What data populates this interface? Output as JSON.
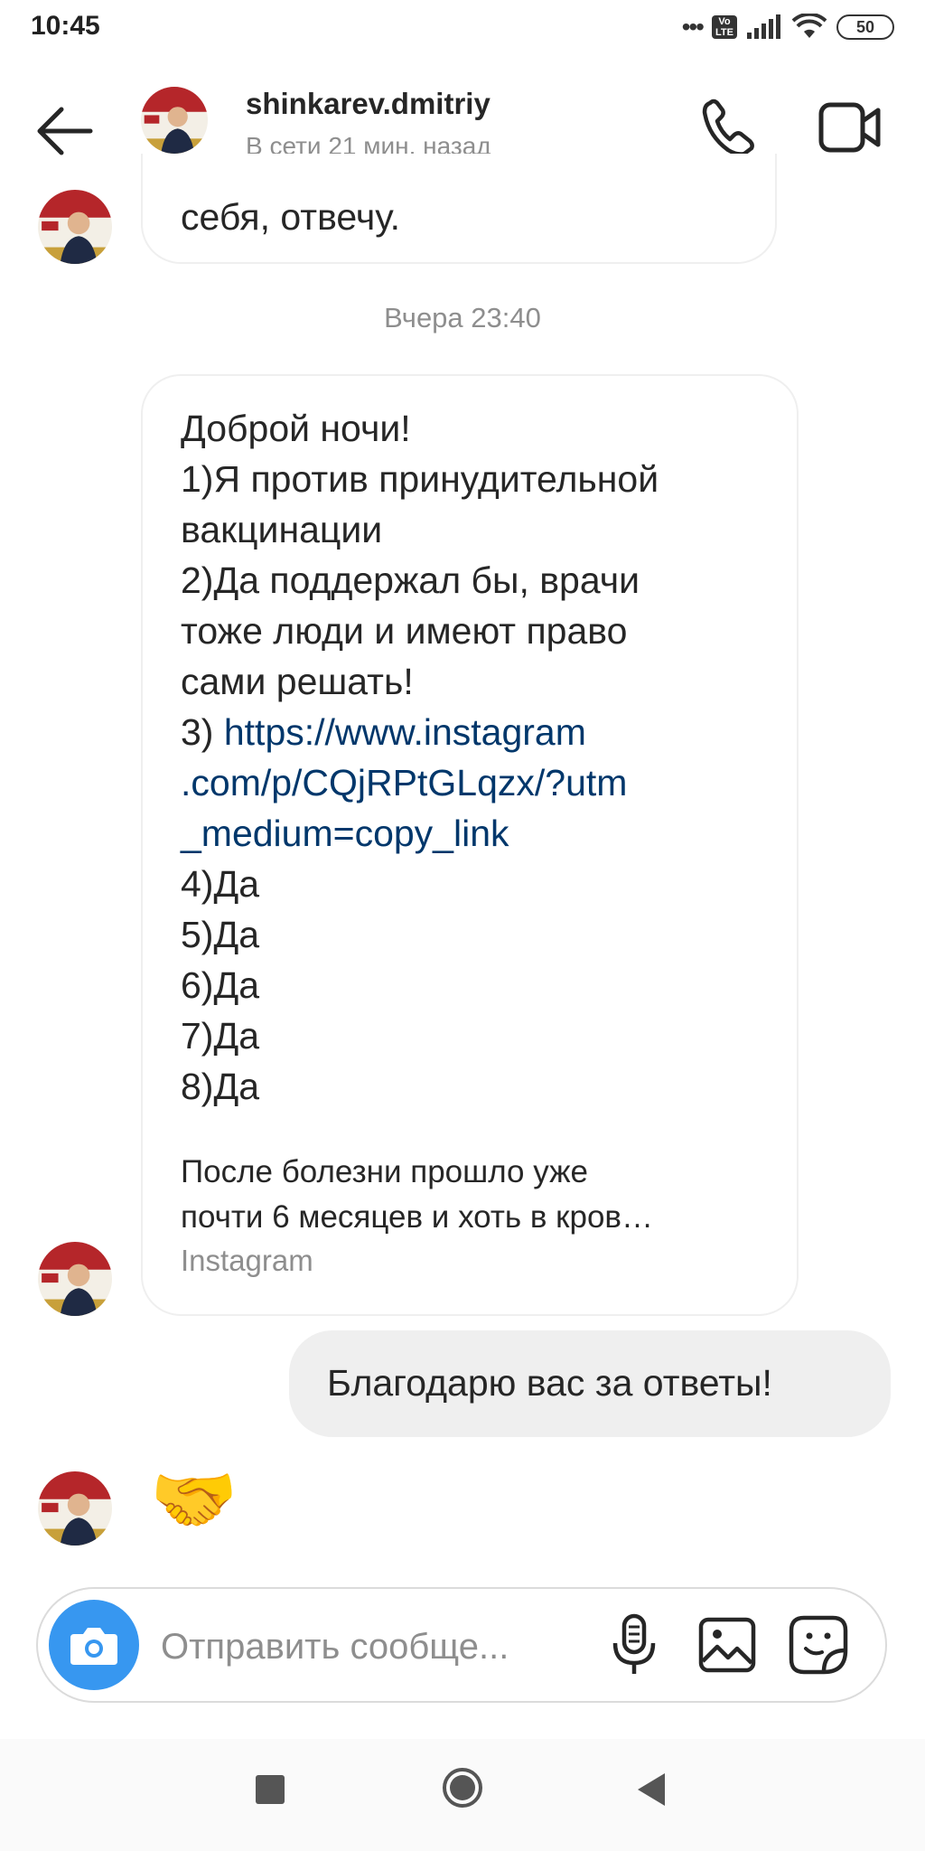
{
  "status_bar": {
    "time": "10:45",
    "signal_dots": "•••",
    "volte": "Vo\nLTE",
    "battery": "50"
  },
  "header": {
    "username": "shinkarev.dmitriy",
    "status": "В сети 21 мин. назад",
    "icons": {
      "back": "back-arrow-icon",
      "call": "phone-icon",
      "video": "video-camera-icon"
    }
  },
  "conversation": {
    "partial_message": "себя, отвечу.",
    "timestamp": "Вчера 23:40",
    "long_message": {
      "lines": [
        "Доброй ночи!",
        "1)Я против принудительной",
        "вакцинации",
        "2)Да поддержал бы, врачи",
        "тоже люди и имеют право",
        "сами решать!"
      ],
      "link_prefix": "3) ",
      "link_lines": [
        "https://www.instagram",
        ".com/p/CQjRPtGLqzx/?utm",
        "_medium=copy_link"
      ],
      "answers": [
        "4)Да",
        "5)Да",
        "6)Да",
        "7)Да",
        "8)Да"
      ],
      "preview": {
        "line1": "После болезни прошло уже",
        "line2": "почти 6 месяцев и хоть в кров…",
        "source": "Instagram"
      }
    },
    "outgoing_message": "Благодарю вас за ответы!",
    "emoji_message": "🤝"
  },
  "composer": {
    "placeholder": "Отправить сообще...",
    "icons": {
      "camera": "camera-icon",
      "mic": "microphone-icon",
      "image": "gallery-icon",
      "sticker": "sticker-icon"
    }
  },
  "colors": {
    "accent": "#3797f0",
    "link": "#00376b",
    "secondary_text": "#8e8e8e",
    "outgoing_bubble": "#efefef"
  }
}
